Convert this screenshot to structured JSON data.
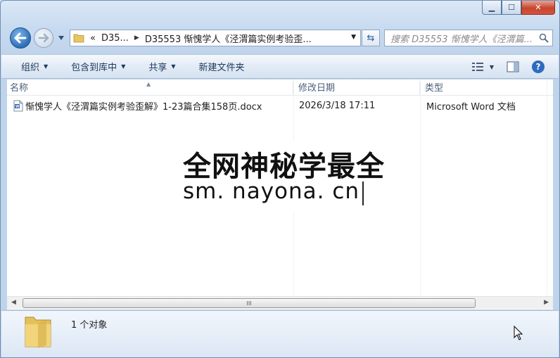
{
  "window": {
    "caption": {
      "minimize": "▁",
      "maximize": "☐",
      "close": "✕"
    }
  },
  "address": {
    "overflow": "«",
    "crumbs": [
      "D35...",
      "D35553 惭愧学人《泾渭篇实例考验歪..."
    ]
  },
  "search": {
    "placeholder": "搜索 D35553 惭愧学人《泾渭篇..."
  },
  "toolbar": {
    "organize": "组织",
    "include_library": "包含到库中",
    "share": "共享",
    "new_folder": "新建文件夹"
  },
  "columns": {
    "name": "名称",
    "modified": "修改日期",
    "type": "类型"
  },
  "files": [
    {
      "name": "惭愧学人《泾渭篇实例考验歪解》1-23篇合集158页.docx",
      "modified": "2026/3/18 17:11",
      "type": "Microsoft Word 文档"
    }
  ],
  "watermark": {
    "line1": "全网神秘学最全",
    "line2": "sm. nayona. cn"
  },
  "scrollbar": {
    "grip": "III"
  },
  "status": {
    "count": "1 个对象"
  },
  "colors": {
    "accent": "#2d6fb8",
    "close": "#c7452f"
  }
}
